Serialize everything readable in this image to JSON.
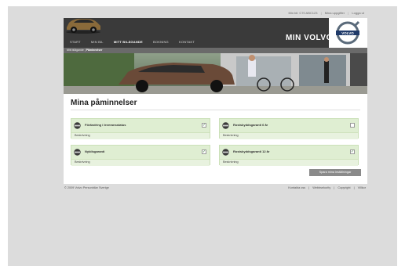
{
  "topbar": {
    "greeting": "Min bil: C70 ABC123",
    "link_details": "Mina uppgifter",
    "link_logout": "Logga ut",
    "sep": "|"
  },
  "header": {
    "brand": "MIN VOLVO",
    "logo_text": "VOLVO"
  },
  "nav": {
    "items": [
      {
        "label": "START"
      },
      {
        "label": "MIN BIL"
      },
      {
        "label": "MITT BILÄGANDE"
      },
      {
        "label": "BOKNING"
      },
      {
        "label": "KONTAKT"
      }
    ]
  },
  "breadcrumb": {
    "parent": "Mitt bilägande",
    "sep": "|",
    "current": "Påminnelser"
  },
  "main": {
    "title": "Mina påminnelser",
    "cards": [
      {
        "title": "Förändring i leveransstatus",
        "desc": "Beskrivning",
        "checked": true
      },
      {
        "title": "Rostskyddsgaranti 6 år",
        "desc": "Beskrivning",
        "checked": false
      },
      {
        "title": "Nybilsgaranti",
        "desc": "Beskrivning",
        "checked": true
      },
      {
        "title": "Rostskyddsgaranti 12 år",
        "desc": "Beskrivning",
        "checked": true
      }
    ],
    "save_label": "Spara mina inställningar"
  },
  "footer": {
    "copyright": "© 2009 Volvo Personbilar Sverige",
    "links": [
      "Kontakta oss",
      "Webbsekurity",
      "Copyright",
      "Villkor"
    ],
    "sep": "|"
  },
  "colors": {
    "card_bg": "#dfeed2",
    "header_bg": "#3a3a3a",
    "button_bg": "#8a8a8a"
  },
  "icons": {
    "card_icon": "volvo-emblem-icon",
    "checkbox": "checkbox-icon"
  }
}
